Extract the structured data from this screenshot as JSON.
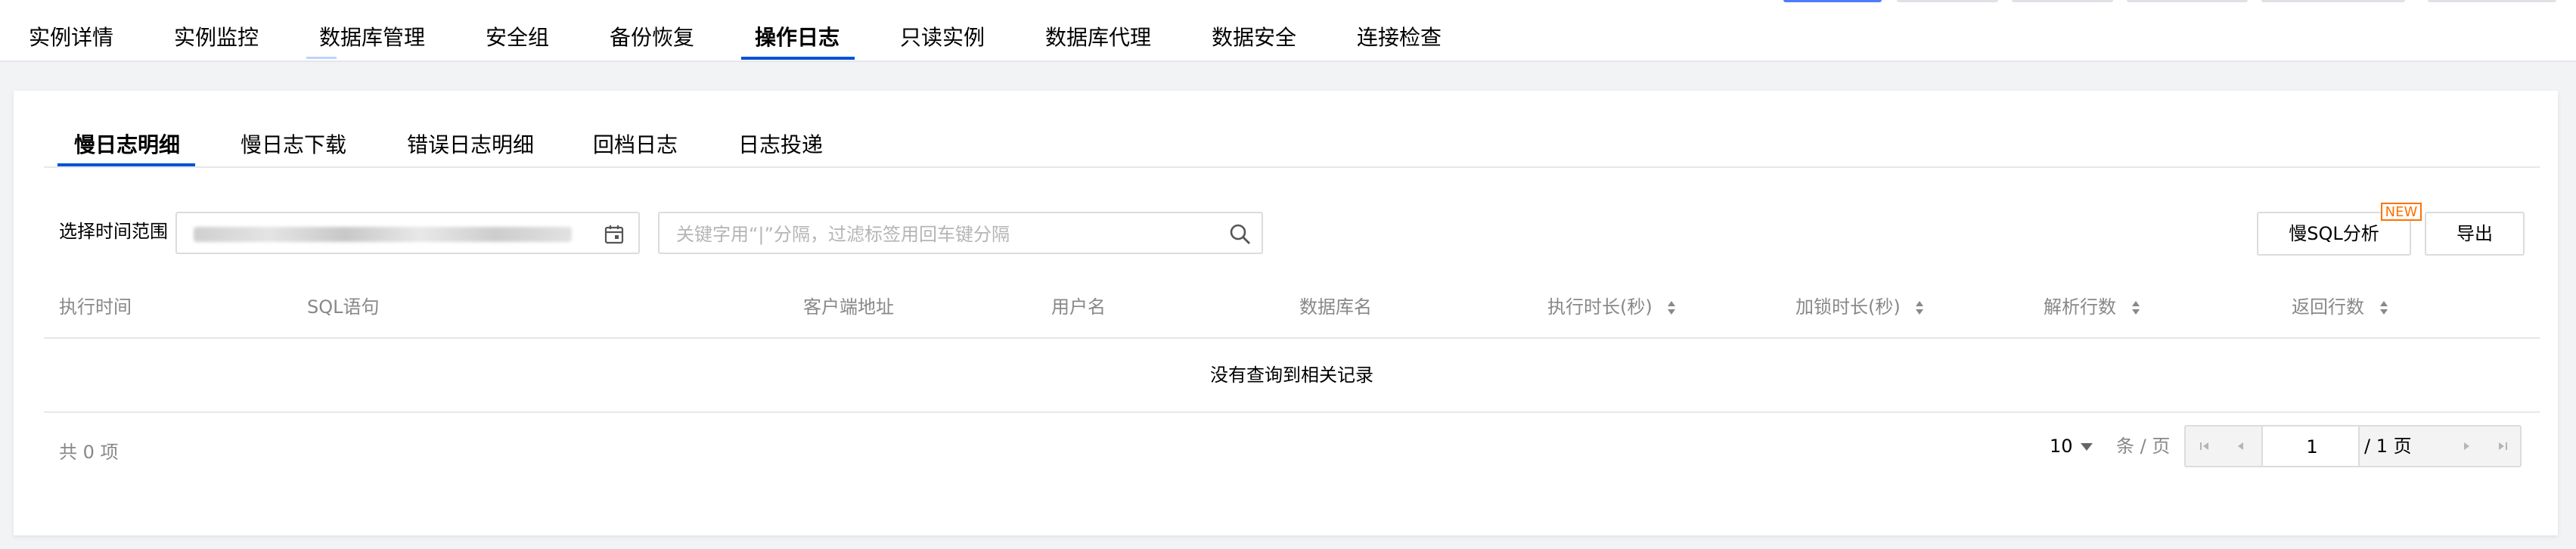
{
  "top_tabs": [
    {
      "label": "实例详情"
    },
    {
      "label": "实例监控"
    },
    {
      "label": "数据库管理"
    },
    {
      "label": "安全组"
    },
    {
      "label": "备份恢复"
    },
    {
      "label": "操作日志"
    },
    {
      "label": "只读实例"
    },
    {
      "label": "数据库代理"
    },
    {
      "label": "数据安全"
    },
    {
      "label": "连接检查"
    }
  ],
  "sub_tabs": [
    {
      "label": "慢日志明细"
    },
    {
      "label": "慢日志下载"
    },
    {
      "label": "错误日志明细"
    },
    {
      "label": "回档日志"
    },
    {
      "label": "日志投递"
    }
  ],
  "filter": {
    "time_range_label": "选择时间范围",
    "search_placeholder": "关键字用“|”分隔，过滤标签用回车键分隔"
  },
  "actions": {
    "slow_sql_label": "慢SQL分析",
    "new_badge": "NEW",
    "export_label": "导出"
  },
  "table": {
    "columns": [
      {
        "label": "执行时间"
      },
      {
        "label": "SQL语句"
      },
      {
        "label": "客户端地址"
      },
      {
        "label": "用户名"
      },
      {
        "label": "数据库名"
      },
      {
        "label": "执行时长(秒)"
      },
      {
        "label": "加锁时长(秒)"
      },
      {
        "label": "解析行数"
      },
      {
        "label": "返回行数"
      }
    ],
    "empty_text": "没有查询到相关记录"
  },
  "pagination": {
    "total_text": "共 0 项",
    "page_size": "10",
    "page_size_unit": "条 / 页",
    "current_page": "1",
    "total_pages_text": "/ 1 页"
  },
  "colors": {
    "accent": "#0052d9",
    "badge": "#ff7200"
  }
}
